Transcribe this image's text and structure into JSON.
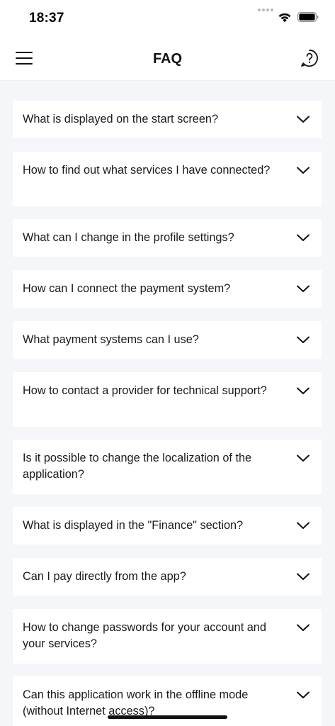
{
  "status_bar": {
    "time": "18:37"
  },
  "header": {
    "title": "FAQ",
    "menu_icon": "hamburger-menu-icon",
    "help_icon": "help-question-chat-icon"
  },
  "faq": {
    "items": [
      {
        "question": "What is displayed on the start screen?"
      },
      {
        "question": "How to find out what services I have connected?"
      },
      {
        "question": "What can I change in the profile settings?"
      },
      {
        "question": "How can I connect the payment system?"
      },
      {
        "question": "What payment systems can I use?"
      },
      {
        "question": "How to contact a provider for technical support?"
      },
      {
        "question": "Is it possible to change the localization of the application?"
      },
      {
        "question": "What is displayed in the \"Finance\" section?"
      },
      {
        "question": "Can I pay directly from the app?"
      },
      {
        "question": "How to change passwords for your account and your services?"
      },
      {
        "question": "Can this application work in the offline mode (without Internet access)?"
      }
    ]
  },
  "colors": {
    "background": "#F5F6F9",
    "card": "#FFFFFF",
    "text": "#1B1B1F"
  }
}
